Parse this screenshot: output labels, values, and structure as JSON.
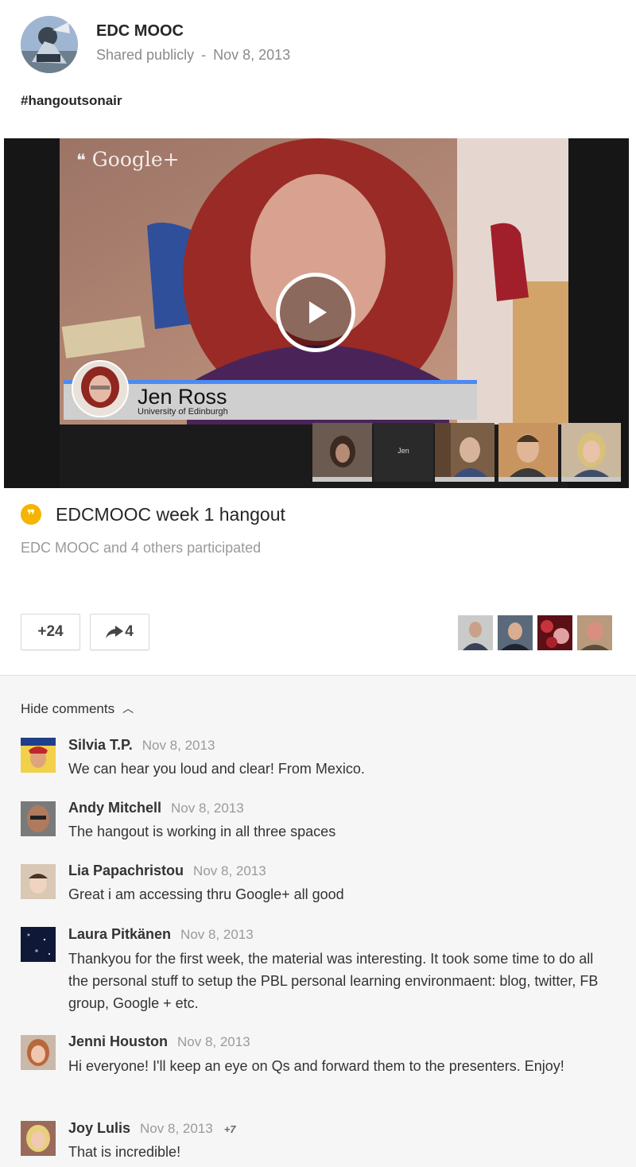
{
  "post": {
    "author": "EDC MOOC",
    "visibility": "Shared publicly",
    "separator": "-",
    "date": "Nov 8, 2013",
    "hashtag": "#hangoutsonair"
  },
  "video": {
    "logo_text": "Google+",
    "speaker_name": "Jen Ross",
    "speaker_org": "University of Edinburgh",
    "thumbnail_center_label": "Jen",
    "progress_accent": "#4a8af4"
  },
  "hangout": {
    "title": "EDCMOOC week 1 hangout",
    "participants_text": "EDC MOOC and 4 others participated",
    "icon_color": "#f4b400"
  },
  "actions": {
    "plus_one_label": "+24",
    "share_count": "4"
  },
  "comments": {
    "toggle_label": "Hide comments",
    "items": [
      {
        "name": "Silvia T.P.",
        "date": "Nov 8, 2013",
        "text": "We can hear you loud and clear! From Mexico."
      },
      {
        "name": "Andy Mitchell",
        "date": "Nov 8, 2013",
        "text": "The hangout is working in all three spaces"
      },
      {
        "name": "Lia Papachristou",
        "date": "Nov 8, 2013",
        "text": "Great i am accessing thru Google+ all good"
      },
      {
        "name": "Laura Pitkänen",
        "date": "Nov 8, 2013",
        "text": "Thankyou for the first week, the material was interesting. It took some time to do all the personal stuff to setup the  PBL personal learning environmaent: blog, twitter, FB group, Google + etc."
      },
      {
        "name": "Jenni Houston",
        "date": "Nov 8, 2013",
        "text": "Hi everyone! I'll keep an eye on Qs and forward them to the presenters. Enjoy!"
      },
      {
        "name": "Joy Lulis",
        "date": "Nov 8, 2013",
        "plus": "+7",
        "text": "That is incredible!"
      }
    ]
  }
}
